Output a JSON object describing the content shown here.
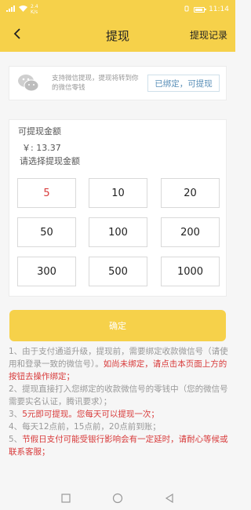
{
  "status_bar": {
    "network": "2.4",
    "speed": "K/s",
    "time": "11:14",
    "colors": {
      "bar": "#f6d14a"
    }
  },
  "header": {
    "title": "提现",
    "right_link": "提现记录",
    "back_icon": "chevron-left-icon"
  },
  "wechat": {
    "icon": "wechat-icon",
    "description": "支持微信提现，提现将转到你的微信零钱",
    "bind_status": "已绑定，可提现"
  },
  "amount": {
    "label": "可提现金额",
    "balance": "￥: 13.37",
    "select_label": "请选择提现金额",
    "options": [
      "5",
      "10",
      "20",
      "50",
      "100",
      "200",
      "300",
      "500",
      "1000"
    ],
    "selected": "5"
  },
  "confirm_label": "确定",
  "notes": [
    {
      "text": "1、由于支付通道升级，提现前，需要绑定收款微信号（请使用和登录一致的微信号）。",
      "red": "如尚未绑定，请点击本页面上方的按钮去操作绑定；"
    },
    {
      "text": "2、提现直接打入您绑定的收款微信号的零钱中（您的微信号需要实名认证，腾讯要求）；",
      "red": ""
    },
    {
      "text": "3、",
      "red": "5元即可提现。您每天可以提现一次；"
    },
    {
      "text": "4、每天12点前，15点前，20点前到账；",
      "red": ""
    },
    {
      "text": "5、",
      "red": "节假日支付可能受银行影响会有一定延时，请耐心等候或联系客服；"
    }
  ],
  "nav": {
    "icons": [
      "square-icon",
      "circle-icon",
      "triangle-back-icon"
    ]
  },
  "colors": {
    "accent": "#f6d14a",
    "warning": "#d83a3a",
    "link": "#5a8fb8"
  }
}
